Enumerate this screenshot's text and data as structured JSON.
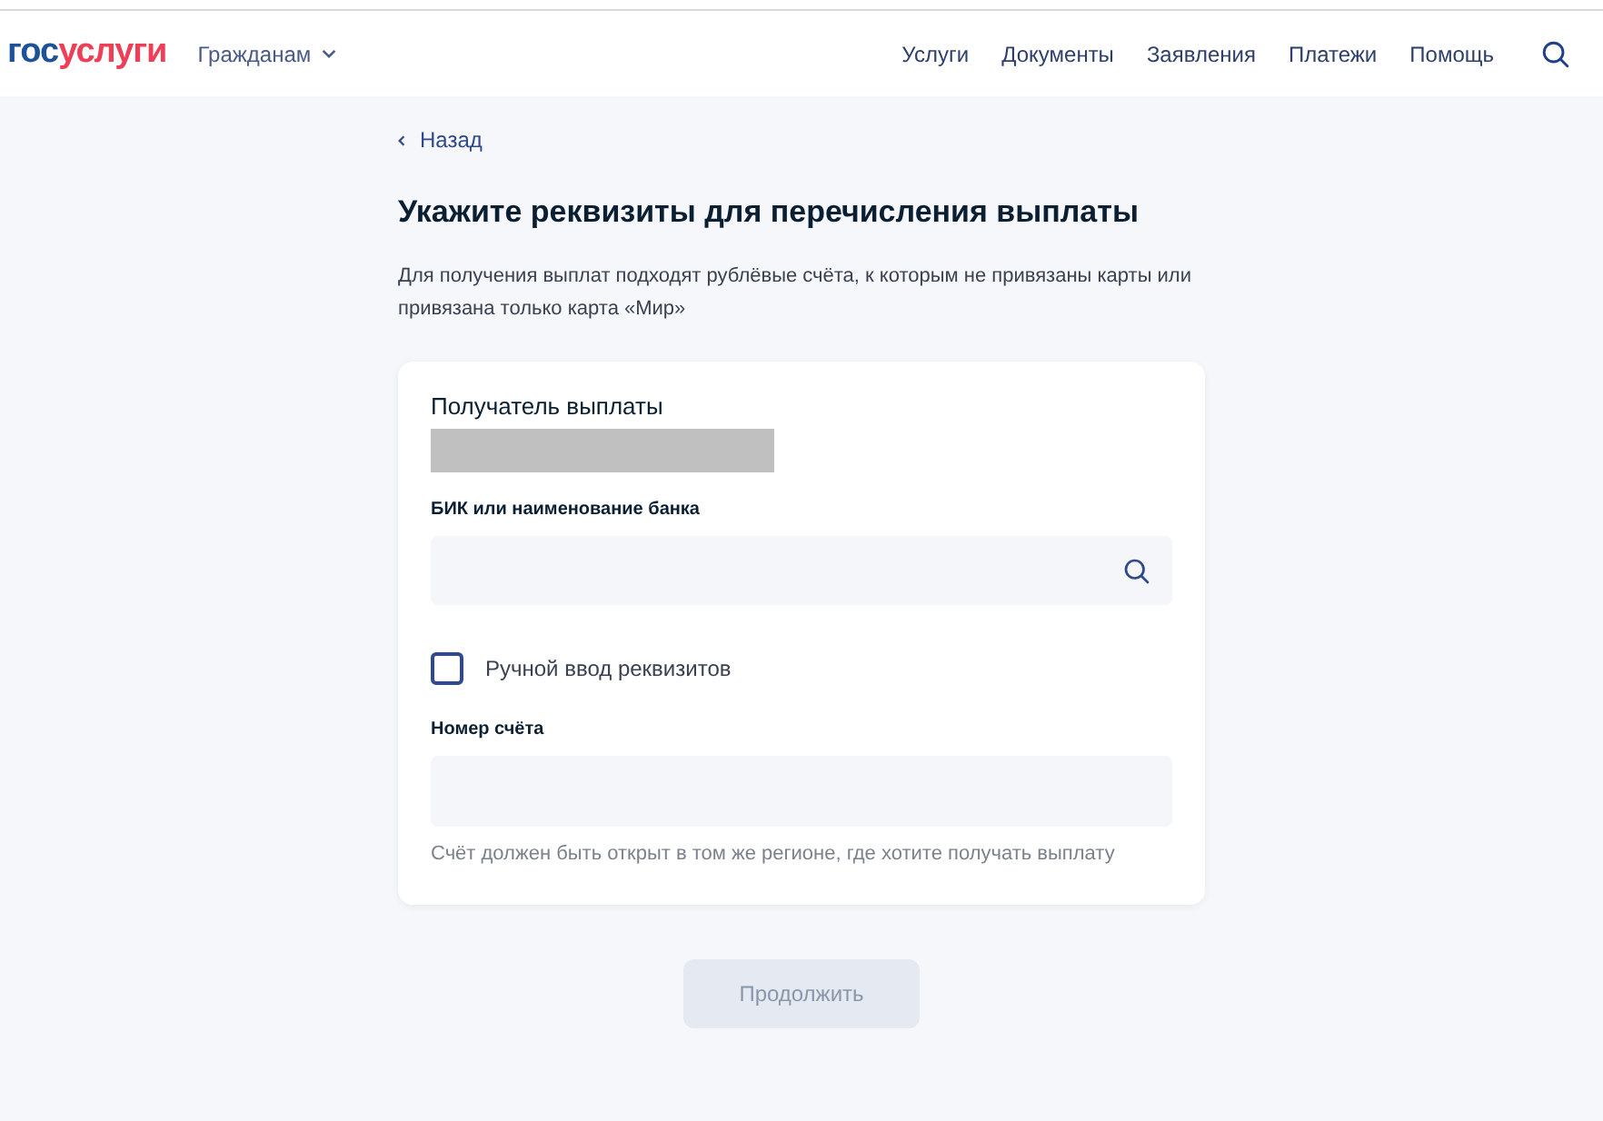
{
  "header": {
    "logo": {
      "first": "гос",
      "second": "услуги"
    },
    "menu": {
      "label": "Гражданам",
      "expanded": false
    },
    "nav": [
      "Услуги",
      "Документы",
      "Заявления",
      "Платежи",
      "Помощь"
    ]
  },
  "back_link": "Назад",
  "title": "Укажите реквизиты для перечисления выплаты",
  "description": "Для получения выплат подходят рублёвые счёта, к которым не привязаны карты или привязана только карта «Мир»",
  "form": {
    "recipient_label": "Получатель выплаты",
    "bank_field": {
      "label": "БИК или наименование банка"
    },
    "manual_entry": {
      "label": "Ручной ввод реквизитов",
      "checked": false
    },
    "account_field": {
      "label": "Номер счёта",
      "hint": "Счёт должен быть открыт в том же регионе, где хотите получать выплату"
    }
  },
  "continue_button": {
    "label": "Продолжить",
    "disabled": true
  }
}
